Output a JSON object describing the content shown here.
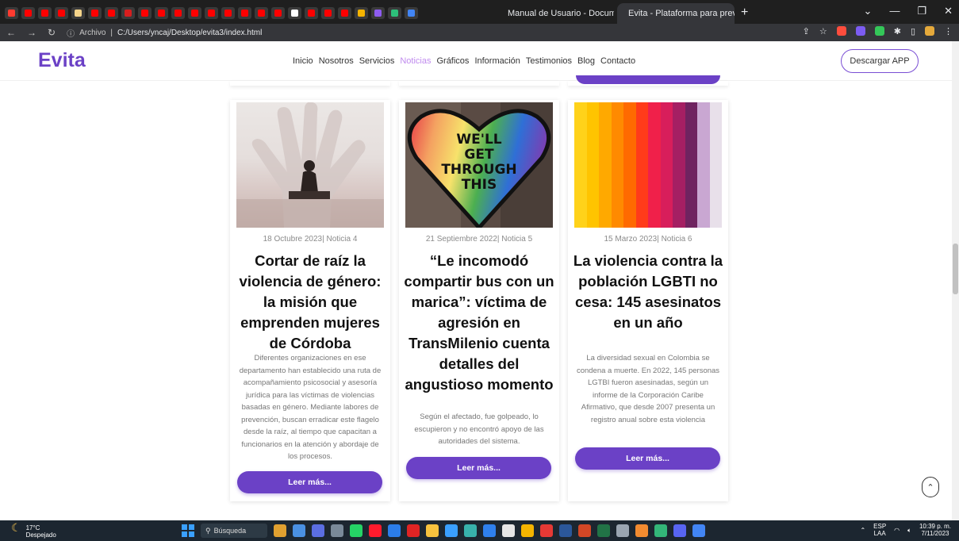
{
  "browser": {
    "tabs": [
      {
        "title": "Manual de Usuario - Document",
        "active": false
      },
      {
        "title": "Evita - Plataforma para preveni",
        "active": true
      }
    ],
    "address": {
      "scheme_label": "Archivo",
      "url": "C:/Users/yncaj/Desktop/evita3/index.html"
    }
  },
  "site": {
    "logo": "Evita",
    "nav": [
      {
        "label": "Inicio"
      },
      {
        "label": "Nosotros"
      },
      {
        "label": "Servicios"
      },
      {
        "label": "Noticias",
        "active": true
      },
      {
        "label": "Gráficos"
      },
      {
        "label": "Información"
      },
      {
        "label": "Testimonios"
      },
      {
        "label": "Blog"
      },
      {
        "label": "Contacto"
      }
    ],
    "download_button": "Descargar APP",
    "accent_color": "#6b41c6"
  },
  "news": [
    {
      "meta": "18 Octubre 2023| Noticia 4",
      "title": "Cortar de raíz la violencia de género: la misión que emprenden mujeres de Córdoba",
      "desc": "Diferentes organizaciones en ese departamento han establecido una ruta de acompañamiento psicosocial y asesoría jurídica para las víctimas de violencias basadas en género. Mediante labores de prevención, buscan erradicar este flagelo desde la raíz, al tiempo que capacitan a funcionarios en la atención y abordaje de los procesos.",
      "button": "Leer más..."
    },
    {
      "meta": "21 Septiembre 2022| Noticia 5",
      "title": "“Le incomodó compartir bus con un marica”: víctima de agresión en TransMilenio cuenta detalles del angustioso momento",
      "desc": "Según el afectado, fue golpeado, lo escupieron y no encontró apoyo de las autoridades del sistema.",
      "button": "Leer más...",
      "image_text": [
        "WE'LL",
        "GET",
        "THROUGH",
        "THIS"
      ]
    },
    {
      "meta": "15 Marzo 2023| Noticia 6",
      "title": "La violencia contra la población LGBTI no cesa: 145 asesinatos en un año",
      "desc": "La diversidad sexual en Colombia se condena a muerte. En 2022, 145 personas LGTBI fueron asesinadas, según un informe de la Corporación Caribe Afirmativo, que desde 2007 presenta un registro anual sobre esta violencia",
      "button": "Leer más...",
      "stripe_colors": [
        "#ffd21a",
        "#ffc400",
        "#ffa900",
        "#ff8a00",
        "#ff6a00",
        "#ff3b1a",
        "#f0204a",
        "#d81e5b",
        "#a51f63",
        "#6f2360",
        "#c9a7d2",
        "#e8e0ea"
      ]
    }
  ],
  "taskbar": {
    "weather_temp": "17°C",
    "weather_text": "Despejado",
    "search_placeholder": "Búsqueda",
    "lang": "ESP",
    "lang_sub": "LAA",
    "time": "10:39 p. m.",
    "date": "7/11/2023"
  }
}
